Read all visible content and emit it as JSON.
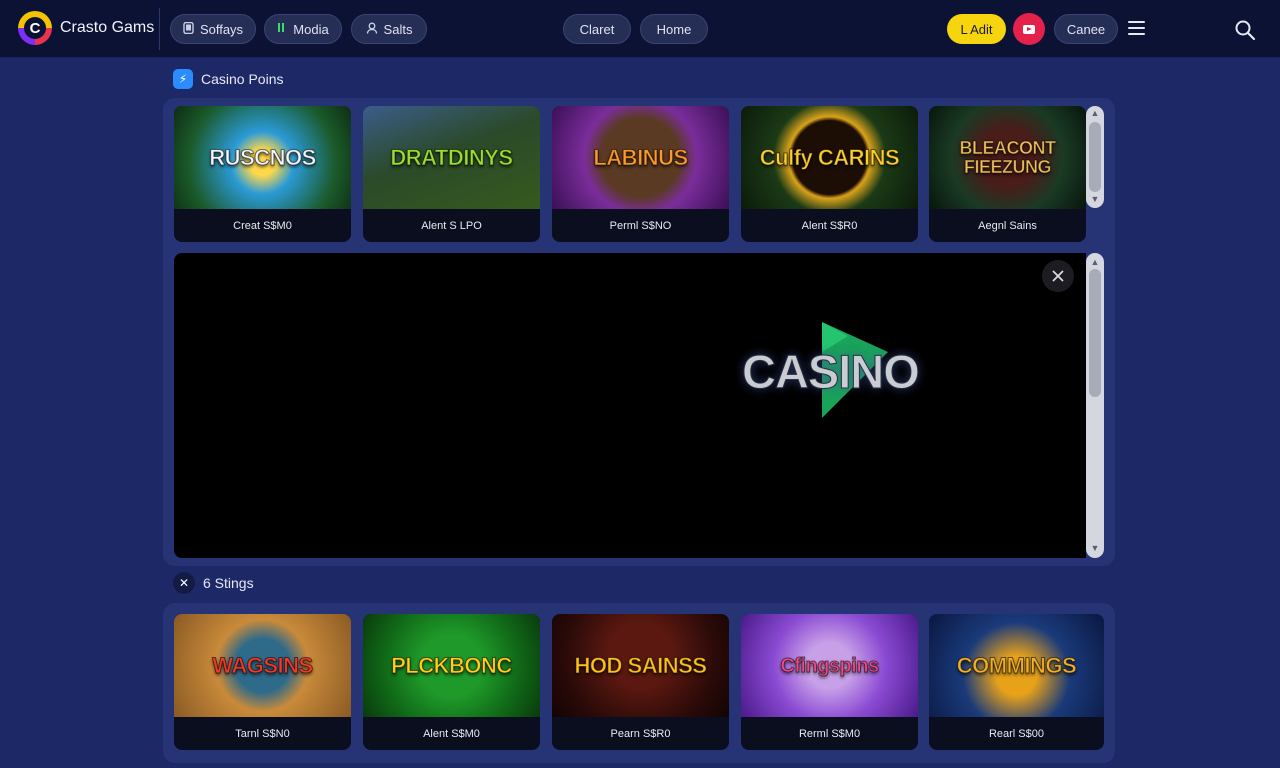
{
  "header": {
    "brand": "Crasto Gams",
    "nav_left": [
      {
        "label": "Soffays",
        "icon": "phone-icon"
      },
      {
        "label": "Modia",
        "icon": "bars-icon"
      },
      {
        "label": "Salts",
        "icon": "user-icon"
      }
    ],
    "nav_center": [
      {
        "label": "Claret"
      },
      {
        "label": "Home"
      }
    ],
    "cta_label": "L Adit",
    "cancel_label": "Canee"
  },
  "section_top": {
    "title": "Casino Poins",
    "cards": [
      {
        "art_title": "RUSCNOS",
        "caption": "Creat S$M0"
      },
      {
        "art_title": "DRATDINYS",
        "caption": "Alent S LPO"
      },
      {
        "art_title": "LABINUS",
        "caption": "Perml S$NO"
      },
      {
        "art_title": "Culfy CARINS",
        "caption": "Alent S$R0"
      },
      {
        "art_title": "BLEACONT FIEEZUNG",
        "caption": "Aegnl Sains"
      }
    ]
  },
  "player": {
    "logo_text": "CASINO"
  },
  "section_bottom": {
    "title": "6 Stings",
    "cards": [
      {
        "art_title": "WAGSINS",
        "caption": "Tarnl S$N0"
      },
      {
        "art_title": "PLCKBONC",
        "caption": "Alent S$M0"
      },
      {
        "art_title": "HOD SAINSS",
        "caption": "Pearn S$R0"
      },
      {
        "art_title": "Cfingspins",
        "caption": "Rerml S$M0"
      },
      {
        "art_title": "COMMINGS",
        "caption": "Rearl S$00"
      }
    ]
  },
  "colors": {
    "background": "#1d2866",
    "topbar": "#0c1233",
    "accent_yellow": "#f6d40e",
    "accent_red": "#e3214a",
    "panel": "#263475"
  }
}
